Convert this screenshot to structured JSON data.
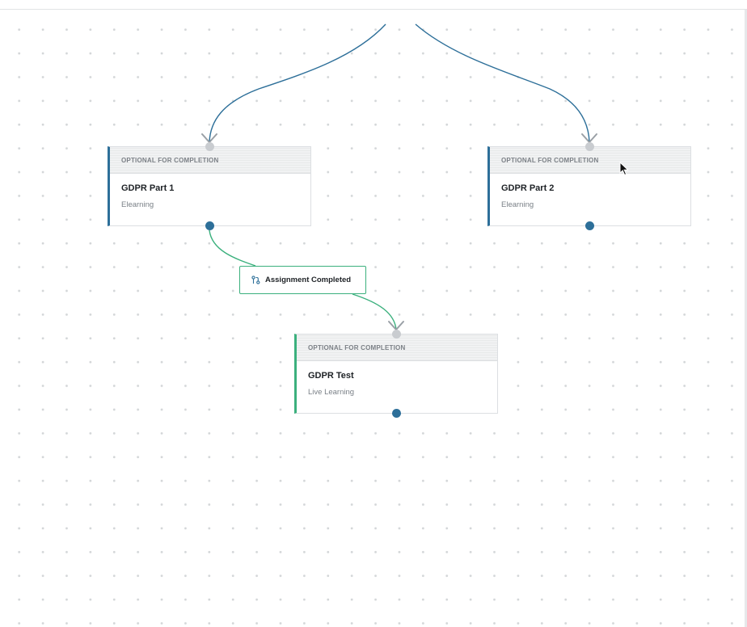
{
  "nodes": [
    {
      "id": "gdpr-part-1",
      "badge": "OPTIONAL FOR COMPLETION",
      "title": "GDPR Part 1",
      "type": "Elearning"
    },
    {
      "id": "gdpr-part-2",
      "badge": "OPTIONAL FOR COMPLETION",
      "title": "GDPR Part 2",
      "type": "Elearning"
    },
    {
      "id": "gdpr-test",
      "badge": "OPTIONAL FOR COMPLETION",
      "title": "GDPR Test",
      "type": "Live Learning"
    }
  ],
  "condition": {
    "label": "Assignment Completed",
    "icon": "branch-condition-icon"
  },
  "colors": {
    "edge_blue": "#2d6f99",
    "edge_green": "#3bb07d",
    "port_in": "#c9ccd0",
    "port_out": "#2d6f99",
    "arrow": "#9aa0a6"
  }
}
